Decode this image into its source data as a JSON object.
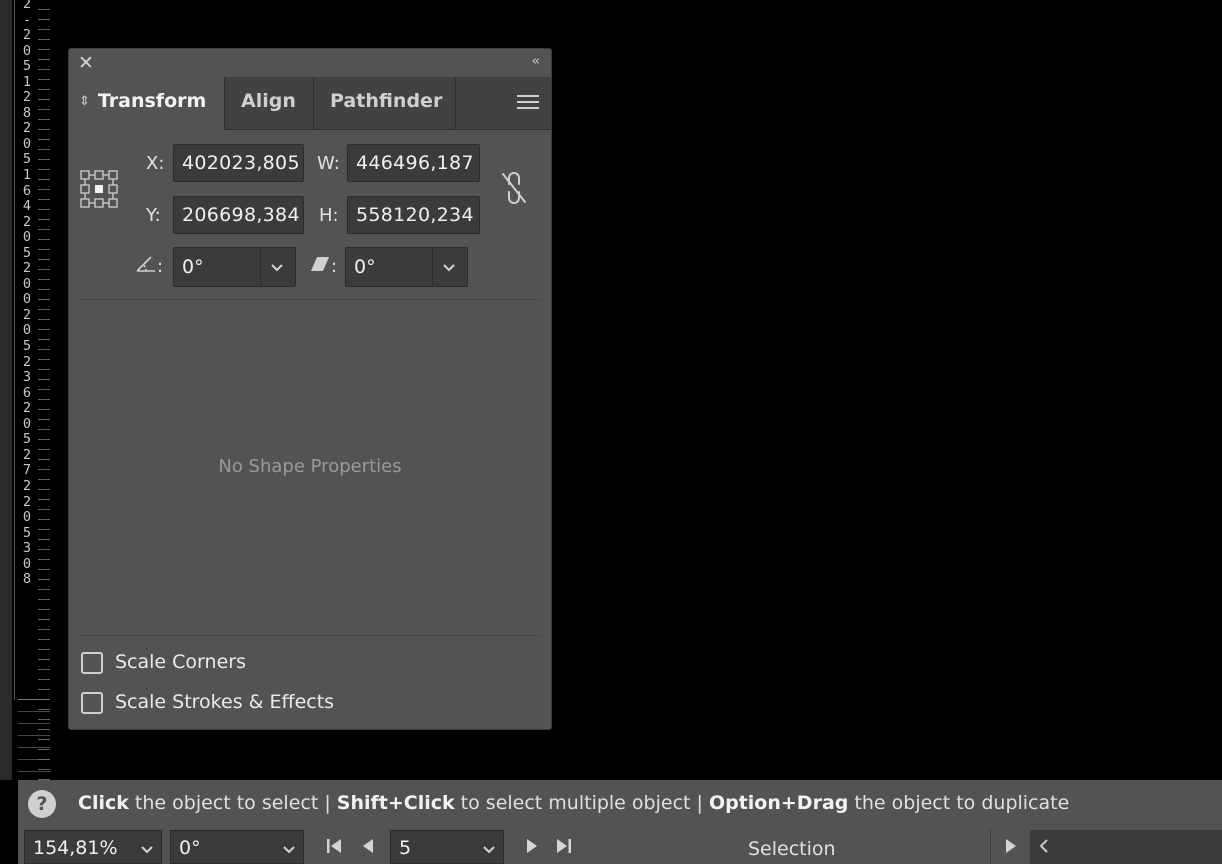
{
  "ruler": {
    "digits": "2-205128205164205200205236205272205308"
  },
  "panel": {
    "tabs": [
      {
        "label": "Transform",
        "active": true
      },
      {
        "label": "Align",
        "active": false
      },
      {
        "label": "Pathfinder",
        "active": false
      }
    ],
    "x_label": "X:",
    "y_label": "Y:",
    "w_label": "W:",
    "h_label": "H:",
    "x_value": "402023,805",
    "y_value": "206698,384",
    "w_value": "446496,187",
    "h_value": "558120,234",
    "angle_label": ":",
    "angle_value": "0°",
    "shear_label": ":",
    "shear_value": "0°",
    "no_shape_text": "No Shape Properties",
    "scale_corners_label": "Scale Corners",
    "scale_strokes_label": "Scale Strokes & Effects",
    "scale_corners_checked": false,
    "scale_strokes_checked": false
  },
  "statusbar": {
    "hint": {
      "part1_bold": "Click",
      "part1": " the object to select  |  ",
      "part2_bold": "Shift+Click",
      "part2": " to select multiple object  |  ",
      "part3_bold": "Option+Drag",
      "part3": " the object to duplicate"
    },
    "zoom": "154,81%",
    "rotation": "0°",
    "artboard": "5",
    "tool": "Selection"
  },
  "colors": {
    "panel_bg": "#535353",
    "field_bg": "#3b3b3b",
    "canvas_bg": "#000000"
  }
}
